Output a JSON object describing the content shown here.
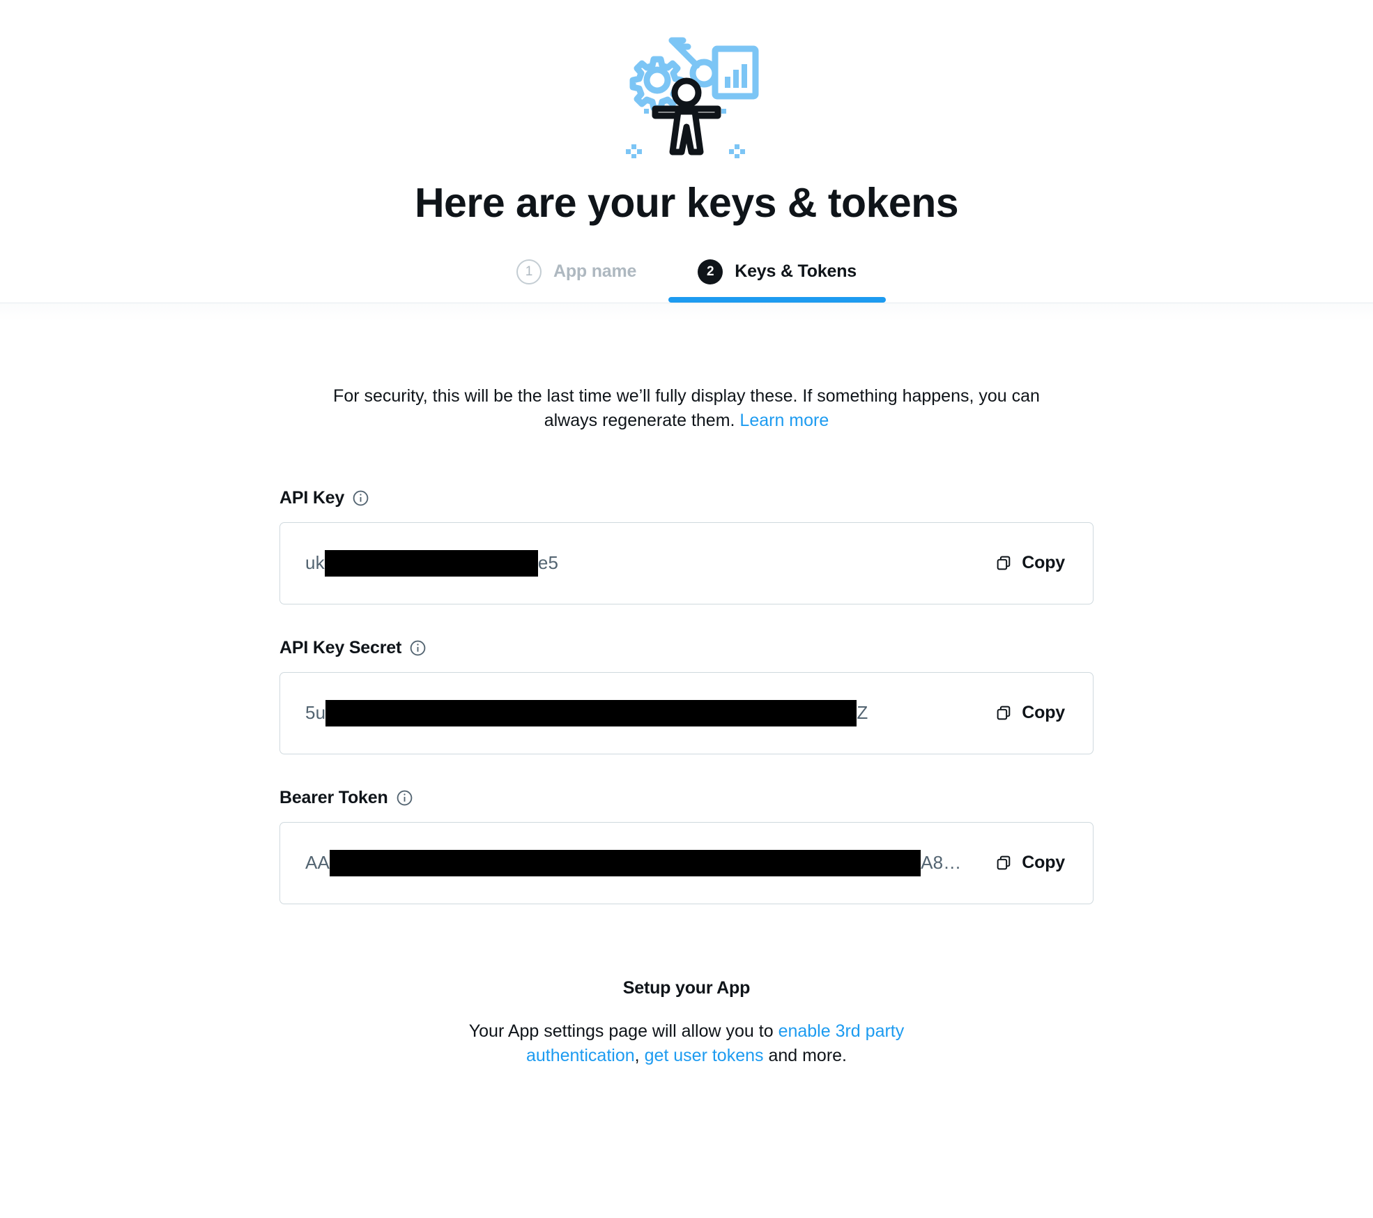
{
  "hero": {
    "icon_name": "developer-portal-illustration",
    "accent_color": "#7CC5F5",
    "figure_color": "#0F1419"
  },
  "header": {
    "title": "Here are your keys & tokens"
  },
  "stepper": {
    "steps": [
      {
        "number": "1",
        "label": "App name",
        "state": "inactive"
      },
      {
        "number": "2",
        "label": "Keys & Tokens",
        "state": "active"
      }
    ],
    "active_color": "#1D9BF0"
  },
  "notice": {
    "text_before_link": "For security, this will be the last time we’ll fully display these. If something happens, you can always regenerate them. ",
    "link_label": "Learn more"
  },
  "fields": [
    {
      "label": "API Key",
      "info_icon": "info-circle-icon",
      "value_prefix": "uk",
      "value_suffix": "e5",
      "redaction_width": 306,
      "copy_label": "Copy",
      "copy_icon": "copy-icon"
    },
    {
      "label": "API Key Secret",
      "info_icon": "info-circle-icon",
      "value_prefix": "5u",
      "value_suffix": "Z",
      "redaction_width": 762,
      "copy_label": "Copy",
      "copy_icon": "copy-icon"
    },
    {
      "label": "Bearer Token",
      "info_icon": "info-circle-icon",
      "value_prefix": "AA",
      "value_suffix": "A8…",
      "redaction_width": 848,
      "copy_label": "Copy",
      "copy_icon": "copy-icon"
    }
  ],
  "footer": {
    "title": "Setup your App",
    "text_part1": "Your App settings page will allow you to ",
    "link1_label": "enable 3rd party authentication",
    "text_part2": ", ",
    "link2_label": "get user tokens",
    "text_part3": " and more."
  },
  "colors": {
    "link": "#1D9BF0",
    "text": "#0F1419",
    "muted": "#536471",
    "border": "#CFD9DE"
  }
}
